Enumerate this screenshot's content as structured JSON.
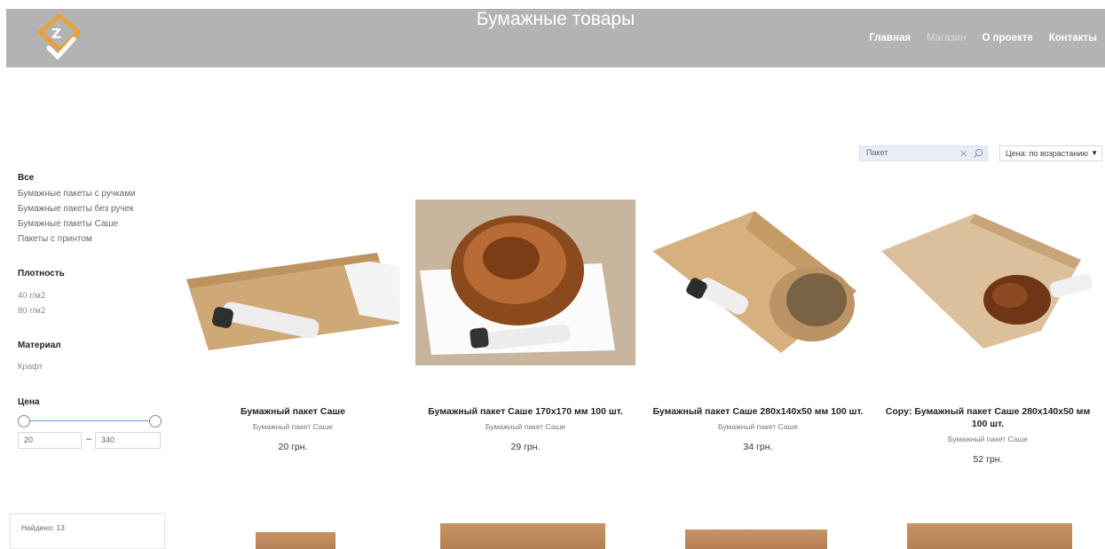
{
  "header": {
    "title": "Бумажные товары",
    "nav": [
      {
        "label": "Главная",
        "active": false
      },
      {
        "label": "Магазин",
        "active": true
      },
      {
        "label": "О проекте",
        "active": false
      },
      {
        "label": "Контакты",
        "active": false
      }
    ]
  },
  "toolbar": {
    "search_value": "Пакет",
    "sort_label": "Цена: по возрастанию"
  },
  "sidebar": {
    "categories_all": "Все",
    "categories": [
      "Бумажные пакеты с ручками",
      "Бумажные пакеты без ручек",
      "Бумажные пакеты Саше",
      "Пакеты с принтом"
    ],
    "density_title": "Плотность",
    "density_options": [
      "40 г/м2",
      "80 г/м2"
    ],
    "material_title": "Материал",
    "material_options": [
      "Крафт"
    ],
    "price_title": "Цена",
    "price_min": "20",
    "price_max": "340",
    "found": "Найдено: 13"
  },
  "products": [
    {
      "title": "Бумажный пакет Саше",
      "category": "Бумажный пакет Саше",
      "price": "20 грн."
    },
    {
      "title": "Бумажный пакет Саше 170x170 мм 100 шт.",
      "category": "Бумажный пакет Саше",
      "price": "29 грн."
    },
    {
      "title": "Бумажный пакет Саше 280x140x50 мм 100 шт.",
      "category": "Бумажный пакет Саше",
      "price": "34 грн."
    },
    {
      "title": "Copy: Бумажный пакет Саше 280x140x50 мм 100 шт.",
      "category": "Бумажный пакет Саше",
      "price": "52 грн."
    }
  ],
  "colors": {
    "header_bg": "#b3b3b3",
    "logo_orange": "#e8a13a",
    "accent_blue": "#5a9ee0"
  }
}
